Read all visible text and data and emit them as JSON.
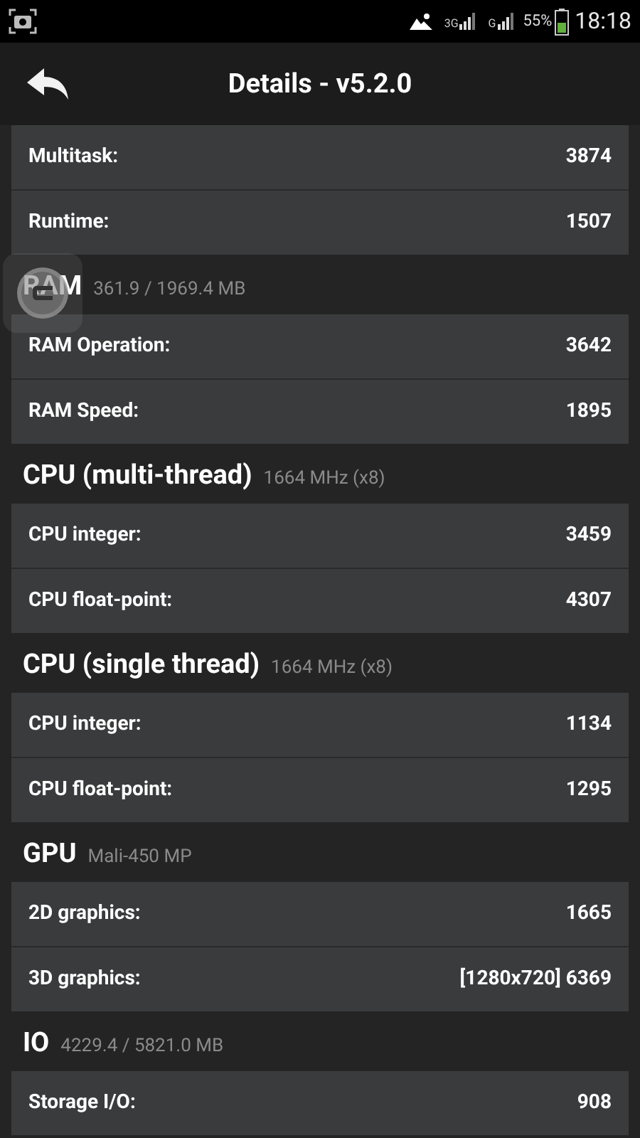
{
  "status_bar": {
    "network_1": "3G",
    "network_2": "G",
    "battery_percent": "55%",
    "time": "18:18"
  },
  "toolbar": {
    "title": "Details - v5.2.0"
  },
  "sections": [
    {
      "rows": [
        {
          "label": "Multitask:",
          "value": "3874"
        },
        {
          "label": "Runtime:",
          "value": "1507"
        }
      ]
    },
    {
      "title": "RAM",
      "subtitle": "361.9 / 1969.4 MB",
      "rows": [
        {
          "label": "RAM Operation:",
          "value": "3642"
        },
        {
          "label": "RAM Speed:",
          "value": "1895"
        }
      ]
    },
    {
      "title": "CPU (multi-thread)",
      "subtitle": "1664 MHz (x8)",
      "rows": [
        {
          "label": "CPU integer:",
          "value": "3459"
        },
        {
          "label": "CPU float-point:",
          "value": "4307"
        }
      ]
    },
    {
      "title": "CPU (single thread)",
      "subtitle": "1664 MHz (x8)",
      "rows": [
        {
          "label": "CPU integer:",
          "value": "1134"
        },
        {
          "label": "CPU float-point:",
          "value": "1295"
        }
      ]
    },
    {
      "title": "GPU",
      "subtitle": "Mali-450 MP",
      "rows": [
        {
          "label": "2D graphics:",
          "value": "1665"
        },
        {
          "label": "3D graphics:",
          "value": "[1280x720] 6369"
        }
      ]
    },
    {
      "title": "IO",
      "subtitle": "4229.4 / 5821.0 MB",
      "rows": [
        {
          "label": "Storage I/O:",
          "value": "908"
        }
      ]
    }
  ]
}
